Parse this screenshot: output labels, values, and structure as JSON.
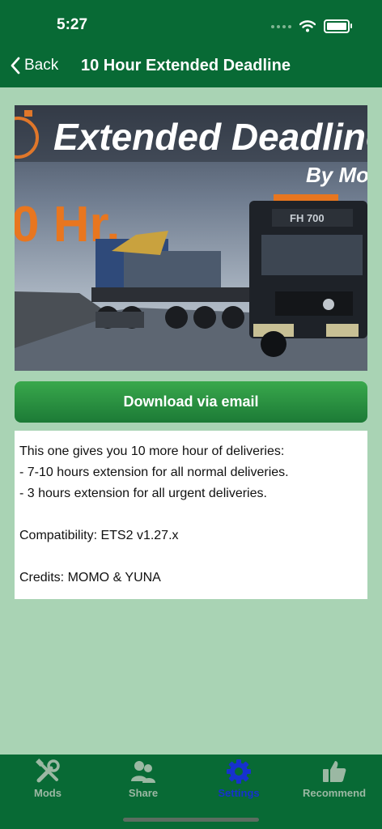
{
  "status": {
    "time": "5:27"
  },
  "nav": {
    "back_label": "Back",
    "title": "10 Hour Extended Deadline"
  },
  "hero": {
    "headline": "Extended Deadline",
    "byline": "By Mo",
    "hours": "0 Hr.",
    "plate": "FH 700"
  },
  "download_label": "Download via email",
  "description": {
    "line1": "This one gives you 10 more hour of deliveries:",
    "line2": "- 7-10 hours extension for all normal deliveries.",
    "line3": "- 3 hours extension for all urgent deliveries.",
    "line4": "Compatibility: ETS2 v1.27.x",
    "line5": "Credits: MOMO & YUNA"
  },
  "tabs": [
    {
      "label": "Mods",
      "icon": "tools-icon"
    },
    {
      "label": "Share",
      "icon": "users-icon"
    },
    {
      "label": "Settings",
      "icon": "gear-icon"
    },
    {
      "label": "Recommend",
      "icon": "thumbs-up-icon"
    }
  ],
  "active_tab": "Settings",
  "colors": {
    "header": "#086a35",
    "background": "#a9d3b4",
    "active_tab": "#1631cf",
    "button": "#2a9242"
  }
}
